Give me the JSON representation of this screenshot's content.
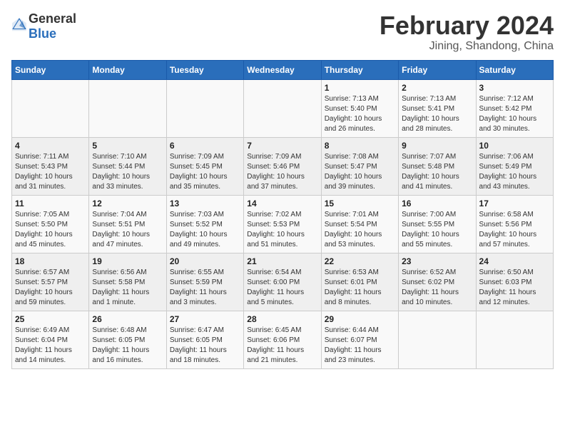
{
  "header": {
    "logo_general": "General",
    "logo_blue": "Blue",
    "main_title": "February 2024",
    "subtitle": "Jining, Shandong, China"
  },
  "weekdays": [
    "Sunday",
    "Monday",
    "Tuesday",
    "Wednesday",
    "Thursday",
    "Friday",
    "Saturday"
  ],
  "weeks": [
    [
      {
        "day": "",
        "info": ""
      },
      {
        "day": "",
        "info": ""
      },
      {
        "day": "",
        "info": ""
      },
      {
        "day": "",
        "info": ""
      },
      {
        "day": "1",
        "info": "Sunrise: 7:13 AM\nSunset: 5:40 PM\nDaylight: 10 hours\nand 26 minutes."
      },
      {
        "day": "2",
        "info": "Sunrise: 7:13 AM\nSunset: 5:41 PM\nDaylight: 10 hours\nand 28 minutes."
      },
      {
        "day": "3",
        "info": "Sunrise: 7:12 AM\nSunset: 5:42 PM\nDaylight: 10 hours\nand 30 minutes."
      }
    ],
    [
      {
        "day": "4",
        "info": "Sunrise: 7:11 AM\nSunset: 5:43 PM\nDaylight: 10 hours\nand 31 minutes."
      },
      {
        "day": "5",
        "info": "Sunrise: 7:10 AM\nSunset: 5:44 PM\nDaylight: 10 hours\nand 33 minutes."
      },
      {
        "day": "6",
        "info": "Sunrise: 7:09 AM\nSunset: 5:45 PM\nDaylight: 10 hours\nand 35 minutes."
      },
      {
        "day": "7",
        "info": "Sunrise: 7:09 AM\nSunset: 5:46 PM\nDaylight: 10 hours\nand 37 minutes."
      },
      {
        "day": "8",
        "info": "Sunrise: 7:08 AM\nSunset: 5:47 PM\nDaylight: 10 hours\nand 39 minutes."
      },
      {
        "day": "9",
        "info": "Sunrise: 7:07 AM\nSunset: 5:48 PM\nDaylight: 10 hours\nand 41 minutes."
      },
      {
        "day": "10",
        "info": "Sunrise: 7:06 AM\nSunset: 5:49 PM\nDaylight: 10 hours\nand 43 minutes."
      }
    ],
    [
      {
        "day": "11",
        "info": "Sunrise: 7:05 AM\nSunset: 5:50 PM\nDaylight: 10 hours\nand 45 minutes."
      },
      {
        "day": "12",
        "info": "Sunrise: 7:04 AM\nSunset: 5:51 PM\nDaylight: 10 hours\nand 47 minutes."
      },
      {
        "day": "13",
        "info": "Sunrise: 7:03 AM\nSunset: 5:52 PM\nDaylight: 10 hours\nand 49 minutes."
      },
      {
        "day": "14",
        "info": "Sunrise: 7:02 AM\nSunset: 5:53 PM\nDaylight: 10 hours\nand 51 minutes."
      },
      {
        "day": "15",
        "info": "Sunrise: 7:01 AM\nSunset: 5:54 PM\nDaylight: 10 hours\nand 53 minutes."
      },
      {
        "day": "16",
        "info": "Sunrise: 7:00 AM\nSunset: 5:55 PM\nDaylight: 10 hours\nand 55 minutes."
      },
      {
        "day": "17",
        "info": "Sunrise: 6:58 AM\nSunset: 5:56 PM\nDaylight: 10 hours\nand 57 minutes."
      }
    ],
    [
      {
        "day": "18",
        "info": "Sunrise: 6:57 AM\nSunset: 5:57 PM\nDaylight: 10 hours\nand 59 minutes."
      },
      {
        "day": "19",
        "info": "Sunrise: 6:56 AM\nSunset: 5:58 PM\nDaylight: 11 hours\nand 1 minute."
      },
      {
        "day": "20",
        "info": "Sunrise: 6:55 AM\nSunset: 5:59 PM\nDaylight: 11 hours\nand 3 minutes."
      },
      {
        "day": "21",
        "info": "Sunrise: 6:54 AM\nSunset: 6:00 PM\nDaylight: 11 hours\nand 5 minutes."
      },
      {
        "day": "22",
        "info": "Sunrise: 6:53 AM\nSunset: 6:01 PM\nDaylight: 11 hours\nand 8 minutes."
      },
      {
        "day": "23",
        "info": "Sunrise: 6:52 AM\nSunset: 6:02 PM\nDaylight: 11 hours\nand 10 minutes."
      },
      {
        "day": "24",
        "info": "Sunrise: 6:50 AM\nSunset: 6:03 PM\nDaylight: 11 hours\nand 12 minutes."
      }
    ],
    [
      {
        "day": "25",
        "info": "Sunrise: 6:49 AM\nSunset: 6:04 PM\nDaylight: 11 hours\nand 14 minutes."
      },
      {
        "day": "26",
        "info": "Sunrise: 6:48 AM\nSunset: 6:05 PM\nDaylight: 11 hours\nand 16 minutes."
      },
      {
        "day": "27",
        "info": "Sunrise: 6:47 AM\nSunset: 6:05 PM\nDaylight: 11 hours\nand 18 minutes."
      },
      {
        "day": "28",
        "info": "Sunrise: 6:45 AM\nSunset: 6:06 PM\nDaylight: 11 hours\nand 21 minutes."
      },
      {
        "day": "29",
        "info": "Sunrise: 6:44 AM\nSunset: 6:07 PM\nDaylight: 11 hours\nand 23 minutes."
      },
      {
        "day": "",
        "info": ""
      },
      {
        "day": "",
        "info": ""
      }
    ]
  ]
}
